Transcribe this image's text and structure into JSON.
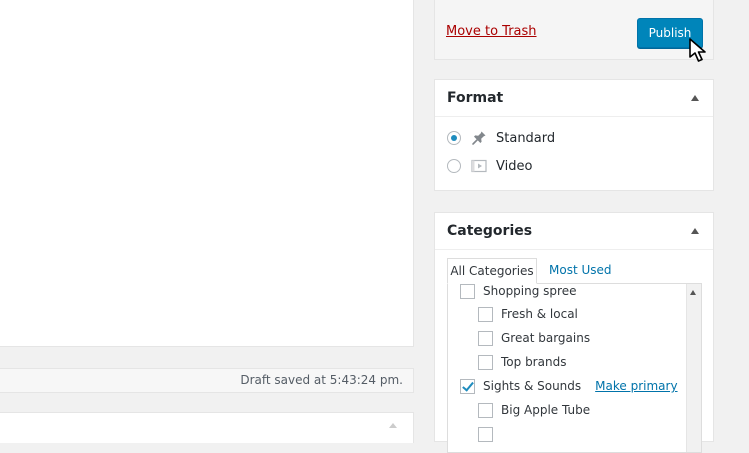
{
  "editor": {
    "status_text": "Draft saved at 5:43:24 pm."
  },
  "publish": {
    "trash_label": "Move to Trash",
    "publish_label": "Publish"
  },
  "format": {
    "title": "Format",
    "options": [
      {
        "label": "Standard",
        "icon": "pin-icon",
        "selected": true
      },
      {
        "label": "Video",
        "icon": "video-icon",
        "selected": false
      }
    ]
  },
  "categories": {
    "title": "Categories",
    "tabs": [
      "All Categories",
      "Most Used"
    ],
    "items": [
      {
        "label": "Shopping spree",
        "checked": false,
        "level": 0
      },
      {
        "label": "Fresh & local",
        "checked": false,
        "level": 1
      },
      {
        "label": "Great bargains",
        "checked": false,
        "level": 1
      },
      {
        "label": "Top brands",
        "checked": false,
        "level": 1
      },
      {
        "label": "Sights & Sounds",
        "checked": true,
        "level": 0,
        "action": "Make primary"
      },
      {
        "label": "Big Apple Tube",
        "checked": false,
        "level": 1
      }
    ]
  },
  "colors": {
    "accent": "#0085ba",
    "link": "#0073aa",
    "trash": "#a00"
  }
}
